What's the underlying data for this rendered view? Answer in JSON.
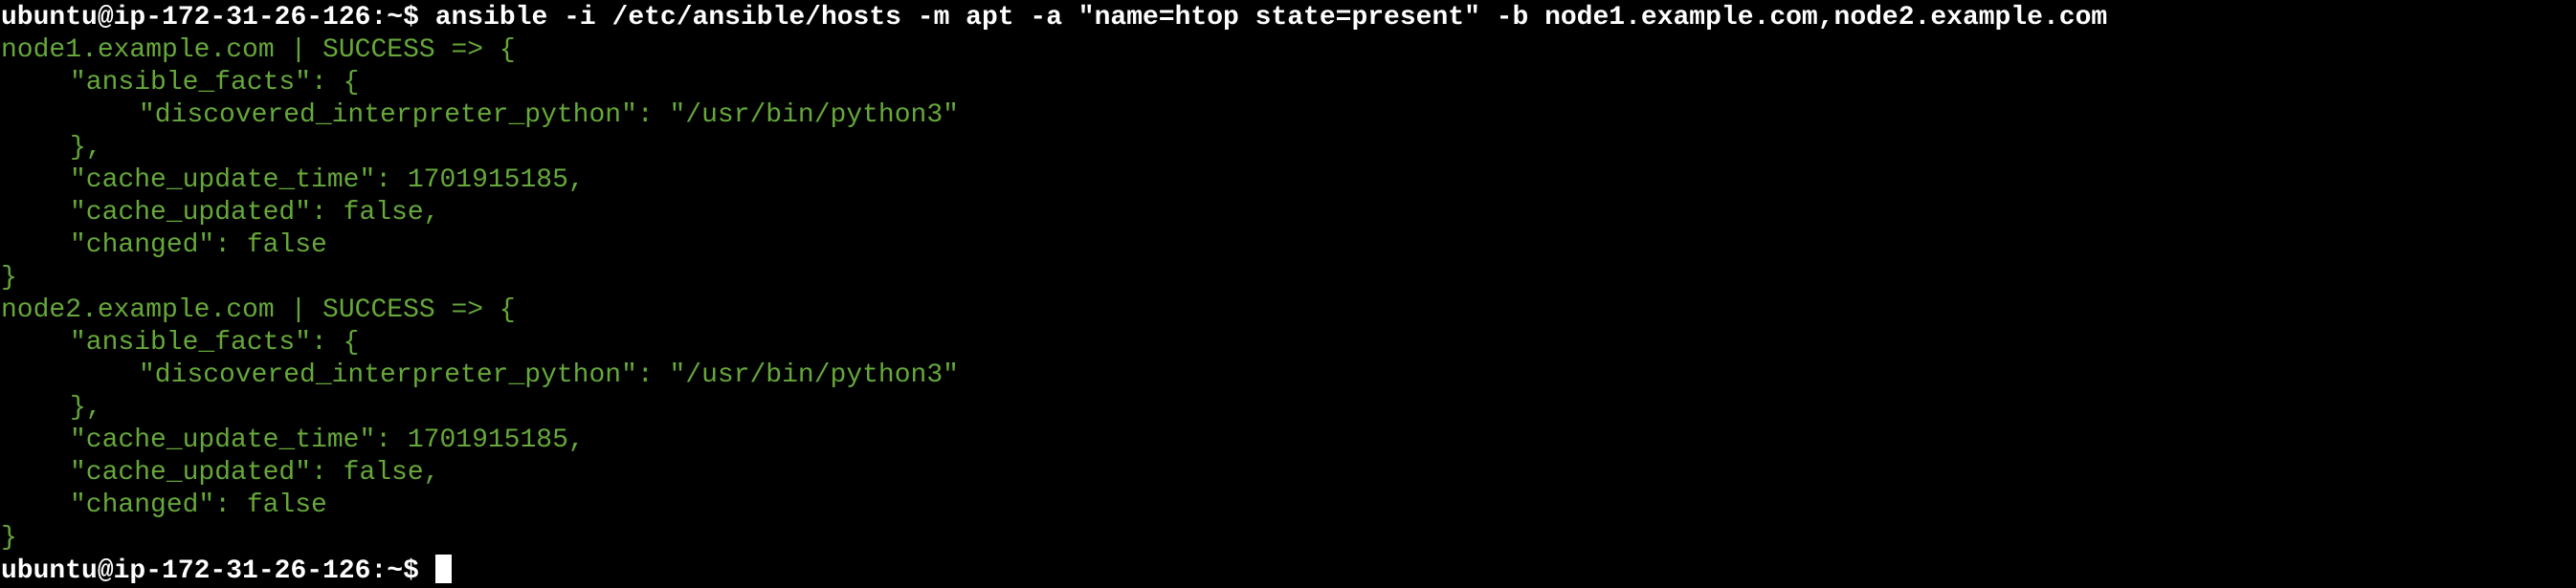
{
  "terminal": {
    "colors": {
      "background": "#000000",
      "command_text": "#ffffff",
      "output_text": "#66a83a",
      "cursor": "#ffffff"
    },
    "command_line": {
      "prompt": "ubuntu@ip-172-31-26-126:~$",
      "command": "ansible -i /etc/ansible/hosts -m apt -a \"name=htop state=present\" -b node1.example.com,node2.example.com"
    },
    "results": [
      {
        "header": "node1.example.com | SUCCESS => {",
        "ansible_facts_open": "\"ansible_facts\": {",
        "interpreter": "\"discovered_interpreter_python\": \"/usr/bin/python3\"",
        "ansible_facts_close": "},",
        "cache_update_time": "\"cache_update_time\": 1701915185,",
        "cache_updated": "\"cache_updated\": false,",
        "changed": "\"changed\": false",
        "close": "}"
      },
      {
        "header": "node2.example.com | SUCCESS => {",
        "ansible_facts_open": "\"ansible_facts\": {",
        "interpreter": "\"discovered_interpreter_python\": \"/usr/bin/python3\"",
        "ansible_facts_close": "},",
        "cache_update_time": "\"cache_update_time\": 1701915185,",
        "cache_updated": "\"cache_updated\": false,",
        "changed": "\"changed\": false",
        "close": "}"
      }
    ],
    "final_prompt": "ubuntu@ip-172-31-26-126:~$"
  }
}
